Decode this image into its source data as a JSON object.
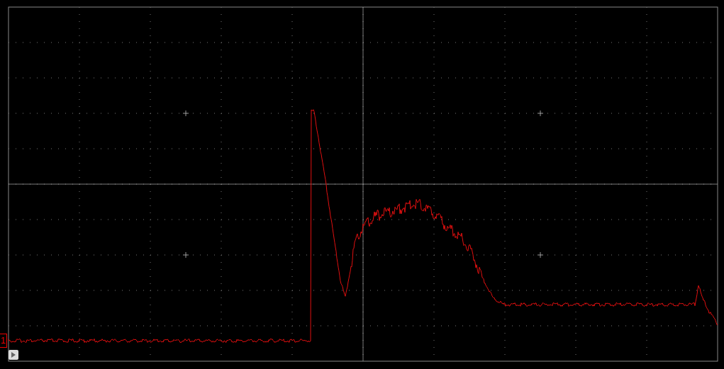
{
  "channel_marker": {
    "label": "1"
  }
}
